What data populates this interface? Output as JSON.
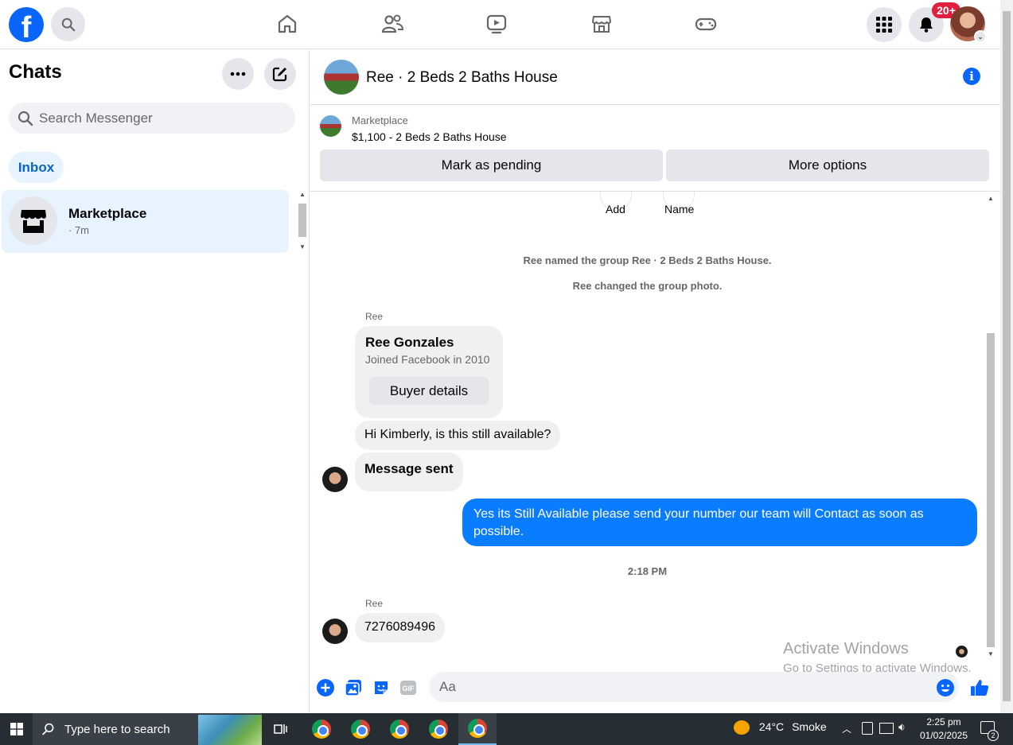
{
  "topbar": {
    "logo": "f",
    "nav_icons": [
      "home-icon",
      "friends-icon",
      "watch-icon",
      "marketplace-icon",
      "gaming-icon"
    ],
    "notification_badge": "20+"
  },
  "sidebar": {
    "title": "Chats",
    "search_placeholder": "Search Messenger",
    "filter_label": "Inbox",
    "chats": [
      {
        "name": "Marketplace",
        "time": "· 7m"
      }
    ]
  },
  "conversation": {
    "title": "Ree · 2 Beds 2 Baths House",
    "marketplace_label": "Marketplace",
    "listing": "$1,100 - 2 Beds 2 Baths House",
    "mark_pending": "Mark as pending",
    "more_options": "More options",
    "add_label": "Add",
    "name_label": "Name",
    "system_1": "Ree named the group Ree · 2 Beds 2 Baths House.",
    "system_2": "Ree changed the group photo.",
    "sender_1": "Ree",
    "card_name": "Ree Gonzales",
    "card_joined": "Joined Facebook in 2010",
    "card_button": "Buyer details",
    "msg_1": "Hi Kimberly, is this still available?",
    "msg_2": "Message sent",
    "reply": "Yes its Still Available please send your number our team will Contact as soon as possible.",
    "timestamp": "2:18 PM",
    "sender_2": "Ree",
    "msg_3": "7276089496",
    "composer_placeholder": "Aa"
  },
  "watermark": {
    "line1": "Activate Windows",
    "line2": "Go to Settings to activate Windows."
  },
  "taskbar": {
    "search_placeholder": "Type here to search",
    "weather_temp": "24°C",
    "weather_desc": "Smoke",
    "time": "2:25 pm",
    "date": "01/02/2025",
    "notification_count": "2"
  },
  "colors": {
    "accent": "#0866ff",
    "outgoing_bubble": "#0a7cff",
    "badge": "#e41e3f",
    "selected_chat": "#e7f3ff"
  }
}
